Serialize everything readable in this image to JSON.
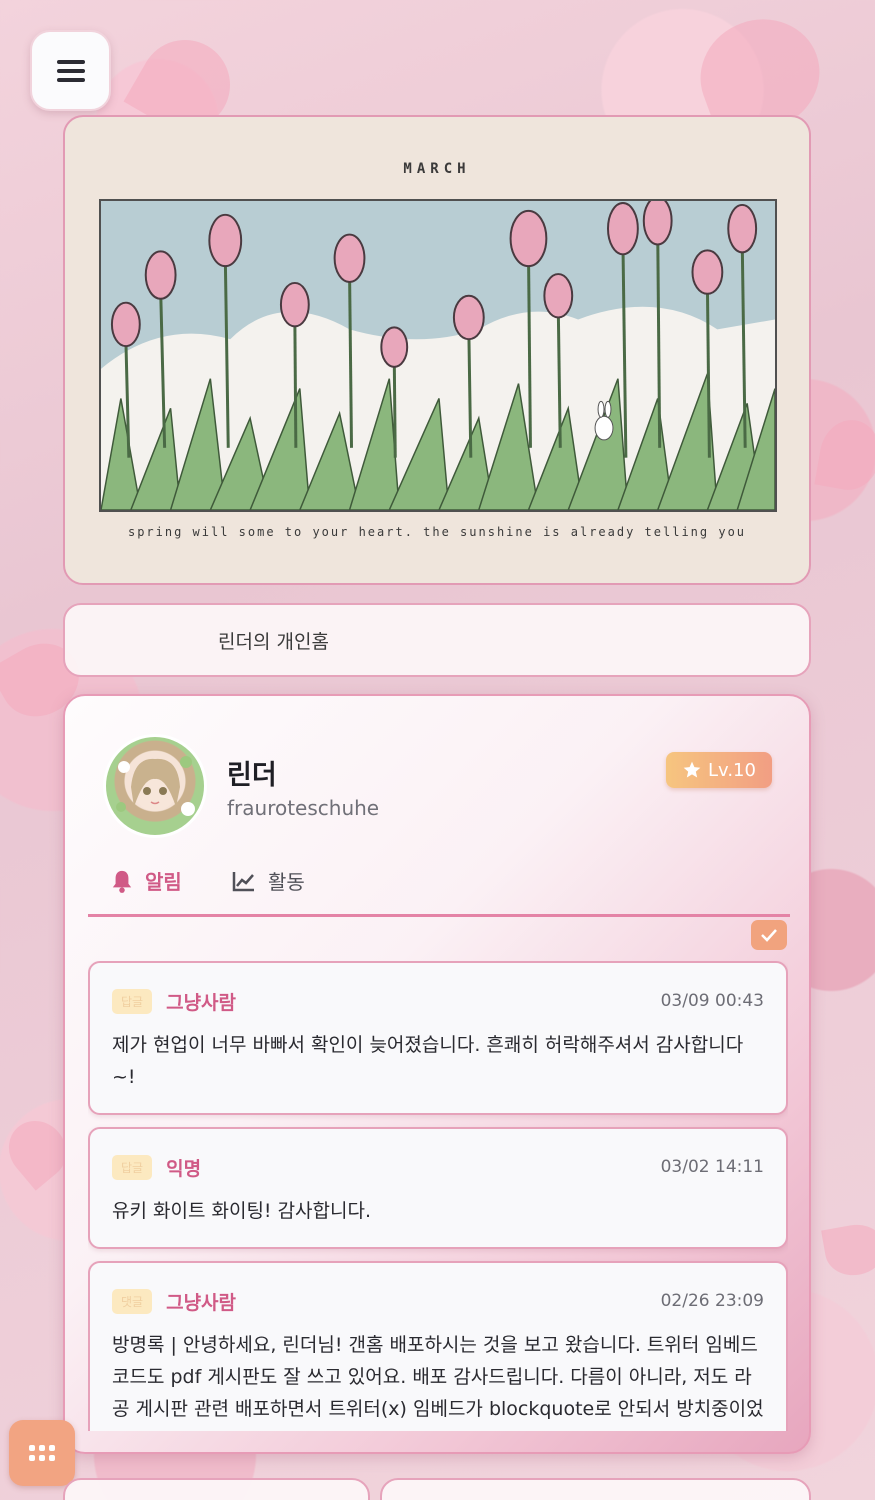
{
  "banner": {
    "month": "MARCH",
    "caption": "spring will some to your heart. the sunshine is already telling you"
  },
  "home_title": "린더의 개인홈",
  "profile": {
    "name": "린더",
    "handle": "frauroteschuhe",
    "level": "Lv.10"
  },
  "tabs": [
    {
      "label": "알림",
      "icon": "bell-icon",
      "active": true
    },
    {
      "label": "활동",
      "icon": "chart-line-icon",
      "active": false
    }
  ],
  "notifications": [
    {
      "type": "답글",
      "author": "그냥사람",
      "time": "03/09 00:43",
      "message": "제가 현업이 너무 바빠서 확인이 늦어졌습니다. 흔쾌히 허락해주셔서 감사합니다~!"
    },
    {
      "type": "답글",
      "author": "익명",
      "time": "03/02 14:11",
      "message": "유키 화이트 화이팅! 감사합니다."
    },
    {
      "type": "댓글",
      "author": "그냥사람",
      "time": "02/26 23:09",
      "message": "방명록 | 안녕하세요, 린더님! 갠홈 배포하시는 것을 보고 왔습니다. 트위터 임베드 코드도 pdf 게시판도 잘 쓰고 있어요. 배포 감사드립니다. 다름이 아니라, 저도 라공 게시판 관련 배포하면서 트위터(x) 임베드가 blockquote로 안되서 방치중이었는데, 혹시 배포해주신 코드를 게시판에 변형 삽입해서 제 게시판 배포에 추가해도 될까요? 제 게시판은"
    }
  ],
  "colors": {
    "accent": "#d05a86",
    "border": "#e6a2ba",
    "level_badge": "#f6c57f",
    "apps_button": "#f2a482"
  },
  "icons": {
    "menu": "hamburger-icon",
    "level": "star-icon",
    "mark_read": "check-icon",
    "apps": "grid-icon"
  }
}
